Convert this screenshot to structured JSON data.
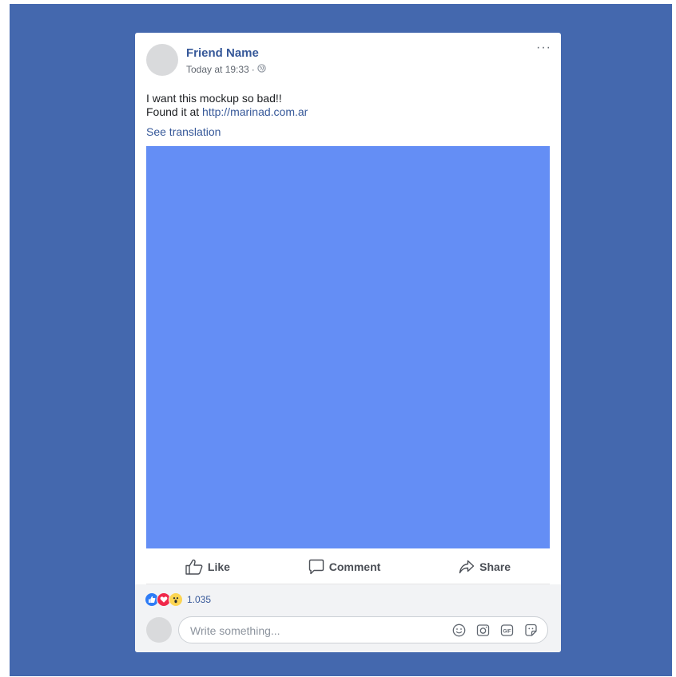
{
  "post": {
    "author": "Friend Name",
    "timestamp": "Today at 19:33",
    "separator": "·",
    "privacy_icon": "globe-icon",
    "menu_label": "···",
    "text_line1": "I want this mockup so bad!!",
    "text_line2_prefix": "Found it at ",
    "link": "http://marinad.com.ar",
    "see_translation": "See translation",
    "photo_color": "#648ef5"
  },
  "actions": {
    "like": "Like",
    "comment": "Comment",
    "share": "Share"
  },
  "reactions": {
    "types": [
      "like-icon",
      "love-icon",
      "wow-icon"
    ],
    "count": "1.035"
  },
  "comment_box": {
    "placeholder": "Write something...",
    "icons": [
      "emoji-icon",
      "camera-icon",
      "gif-icon",
      "sticker-icon"
    ]
  },
  "colors": {
    "background": "#4468ae",
    "link": "#365899",
    "like_reaction": "#2e7cf6",
    "love_reaction": "#f0284a",
    "wow_reaction": "#fcd553"
  }
}
